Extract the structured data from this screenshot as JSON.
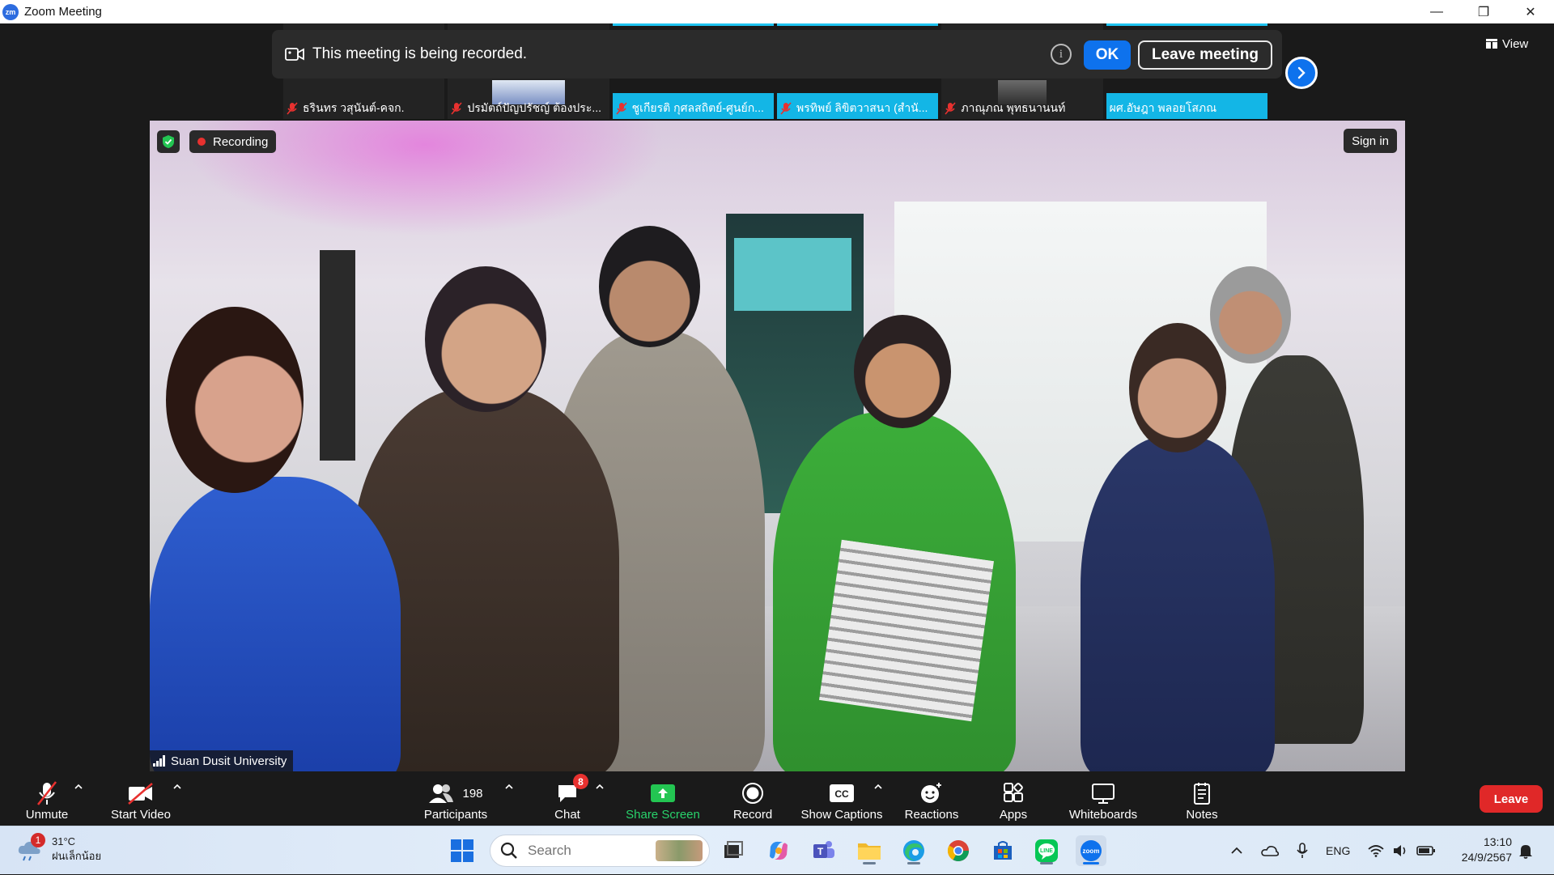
{
  "window": {
    "title": "Zoom Meeting",
    "logo_text": "zm",
    "minimize": "—",
    "restore": "❐",
    "close": "✕"
  },
  "banner": {
    "text": "This meeting is being recorded.",
    "info": "i",
    "ok_label": "OK",
    "leave_meeting_label": "Leave meeting"
  },
  "view": {
    "label": "View"
  },
  "participants_strip": [
    {
      "name": "ธรินทร วสุนันต์-คจก."
    },
    {
      "name": "ปรมัตถ์ปัญปรัชญ์ ต้องประ..."
    },
    {
      "name": "ชูเกียรติ กุศลสถิตย์-ศูนย์ก..."
    },
    {
      "name": "พรทิพย์ ลิขิตวาสนา (สำนั..."
    },
    {
      "name": "ภาณุภณ พุทธนานนท์"
    },
    {
      "name": "ผศ.อัษฎา พลอยโสภณ"
    }
  ],
  "video": {
    "recording_label": "Recording",
    "sign_in_label": "Sign in",
    "speaker_name": "Suan Dusit University"
  },
  "toolbar": {
    "unmute": "Unmute",
    "start_video": "Start Video",
    "participants": "Participants",
    "participants_count": "198",
    "chat": "Chat",
    "chat_badge": "8",
    "share_screen": "Share Screen",
    "record": "Record",
    "show_captions": "Show Captions",
    "captions_icon_text": "CC",
    "reactions": "Reactions",
    "apps": "Apps",
    "whiteboards": "Whiteboards",
    "notes": "Notes",
    "leave": "Leave"
  },
  "taskbar": {
    "weather_temp": "31°C",
    "weather_desc": "ฝนเล็กน้อย",
    "weather_badge": "1",
    "search_placeholder": "Search",
    "language": "ENG",
    "time": "13:10",
    "date": "24/9/2567"
  },
  "colors": {
    "zoom_blue": "#0e72ed",
    "leave_red": "#e02828",
    "share_green": "#28d36b",
    "recording_red": "#e8312f"
  }
}
